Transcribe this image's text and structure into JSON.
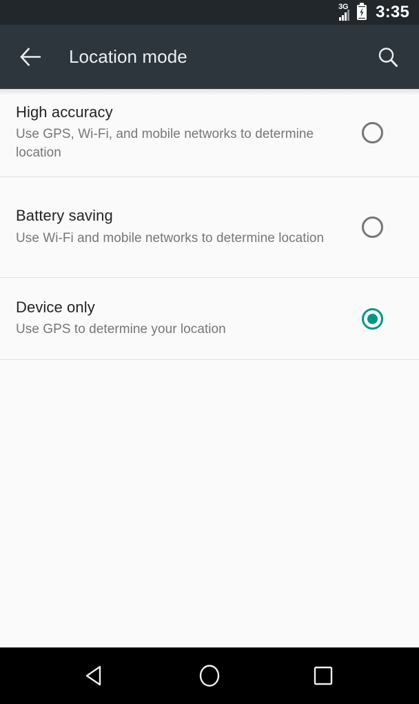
{
  "status_bar": {
    "network_type": "3G",
    "signal_bars_filled": 3,
    "signal_bars_total": 4,
    "battery_state": "charging",
    "time": "3:35",
    "background_color": "#22272b"
  },
  "app_bar": {
    "title": "Location mode",
    "back_icon": "back-arrow-icon",
    "search_icon": "search-icon",
    "background_color": "#2d363d",
    "title_color": "#eceff1"
  },
  "options": [
    {
      "title": "High accuracy",
      "subtitle": "Use GPS, Wi-Fi, and mobile networks to determine location",
      "selected": false
    },
    {
      "title": "Battery saving",
      "subtitle": "Use Wi-Fi and mobile networks to determine location",
      "selected": false
    },
    {
      "title": "Device only",
      "subtitle": "Use GPS to determine your location",
      "selected": true
    }
  ],
  "theme": {
    "accent_color": "#009688",
    "background_color": "#fafafa",
    "radio_unselected_color": "#757575",
    "divider_color": "#e4e4e4"
  },
  "nav_bar": {
    "background_color": "#000000",
    "buttons": [
      {
        "name": "back-nav-button",
        "icon": "triangle-back-icon"
      },
      {
        "name": "home-nav-button",
        "icon": "circle-home-icon"
      },
      {
        "name": "recents-nav-button",
        "icon": "square-recents-icon"
      }
    ]
  }
}
